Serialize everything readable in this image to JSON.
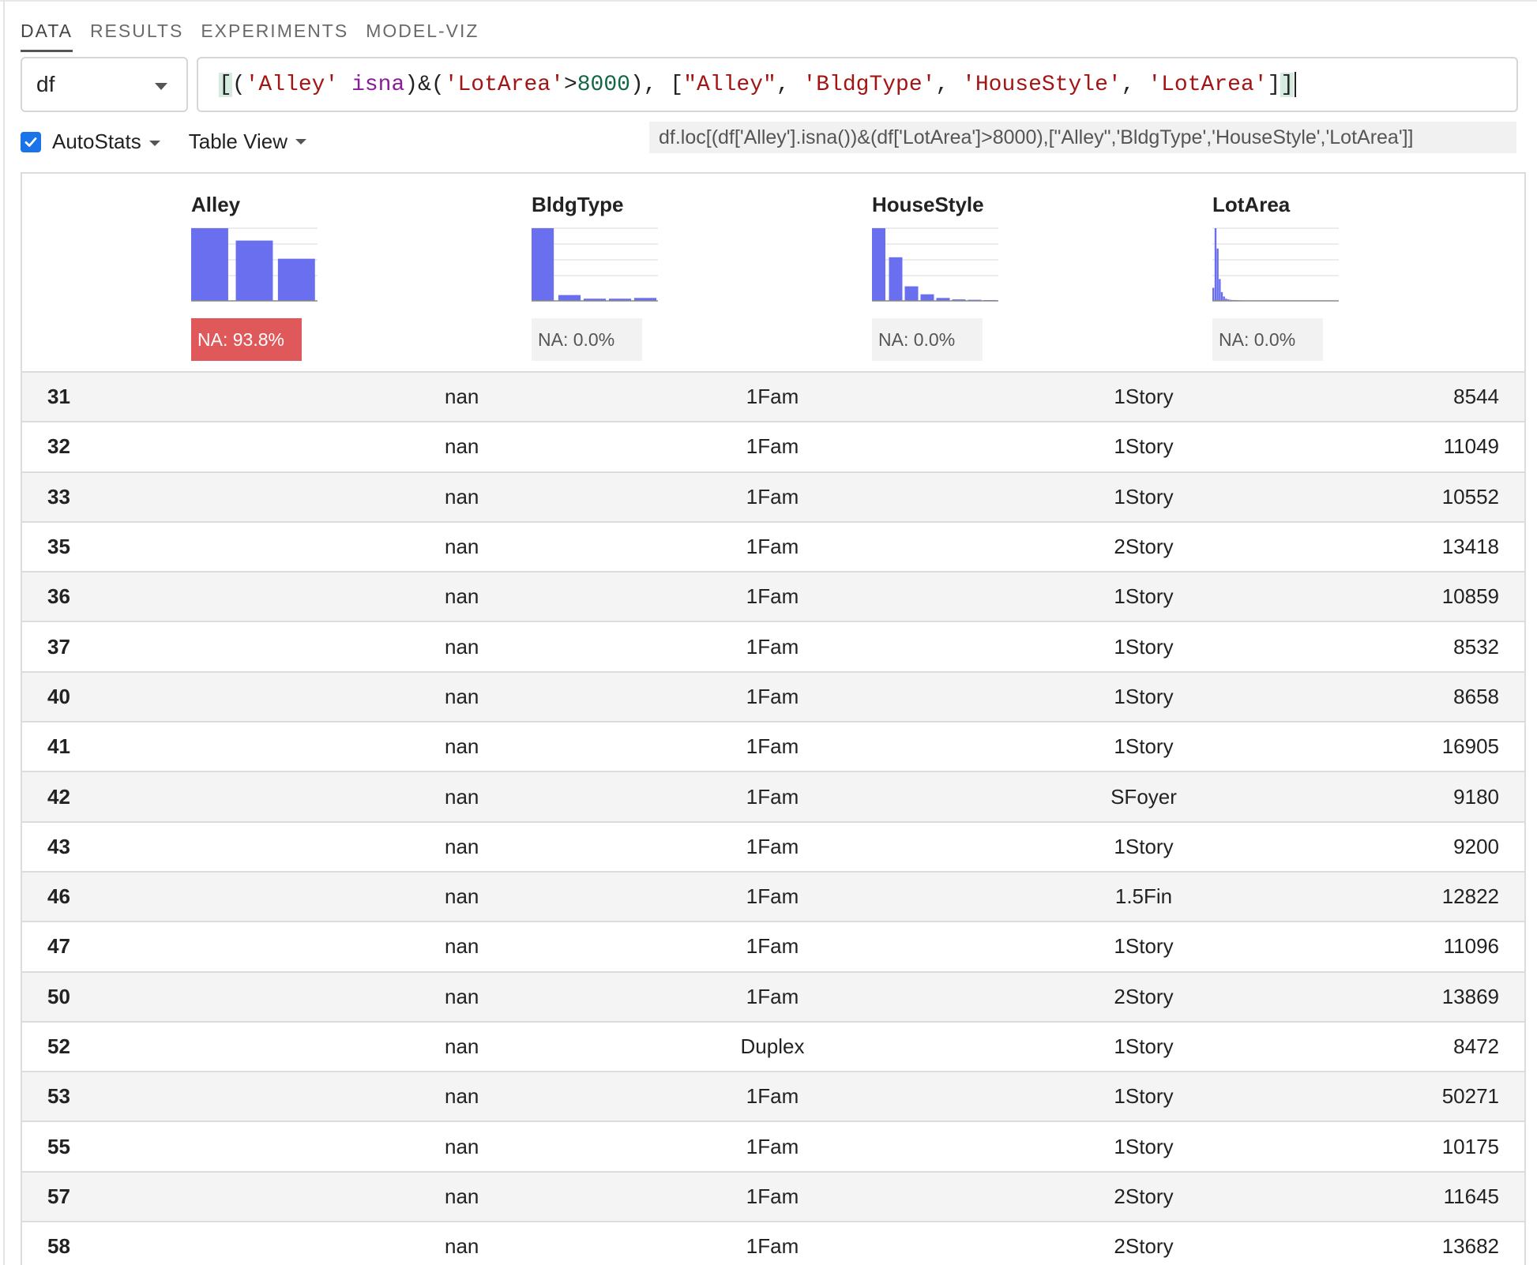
{
  "tabs": [
    {
      "label": "DATA",
      "active": true
    },
    {
      "label": "RESULTS",
      "active": false
    },
    {
      "label": "EXPERIMENTS",
      "active": false
    },
    {
      "label": "MODEL-VIZ",
      "active": false
    }
  ],
  "dataframe_select": {
    "value": "df"
  },
  "query": {
    "value": "[('Alley' isna)&('LotArea'>8000), [\"Alley\", 'BldgType', 'HouseStyle', 'LotArea']]"
  },
  "options": {
    "autostats_label": "AutoStats",
    "autostats_checked": true,
    "view_label": "Table View"
  },
  "code_preview": "df.loc[(df['Alley'].isna())&(df['LotArea']>8000),[\"Alley\",'BldgType','HouseStyle','LotArea']]",
  "columns": [
    {
      "name": "Alley",
      "na": "NA: 93.8%",
      "na_alert": true,
      "hist": [
        1.0,
        0.83,
        0.58
      ]
    },
    {
      "name": "BldgType",
      "na": "NA: 0.0%",
      "na_alert": false,
      "hist": [
        1.0,
        0.08,
        0.03,
        0.03,
        0.04
      ]
    },
    {
      "name": "HouseStyle",
      "na": "NA: 0.0%",
      "na_alert": false,
      "hist": [
        1.0,
        0.6,
        0.2,
        0.09,
        0.04,
        0.02,
        0.015,
        0.01
      ]
    },
    {
      "name": "LotArea",
      "na": "NA: 0.0%",
      "na_alert": false,
      "hist": [
        0.18,
        1.0,
        0.72,
        0.3,
        0.12,
        0.06,
        0.03,
        0.02,
        0.015,
        0.012,
        0.01,
        0.01,
        0.008,
        0.008,
        0.006,
        0.006,
        0.005,
        0.005,
        0.004,
        0.004,
        0.004,
        0.003,
        0.003,
        0.003,
        0.003,
        0.003,
        0.003,
        0.003,
        0.003,
        0.003,
        0.003,
        0.003,
        0.003,
        0.003,
        0.003,
        0.003,
        0.003,
        0.003,
        0.003,
        0.003,
        0.003,
        0.003,
        0.003,
        0.003,
        0.003,
        0.003,
        0.003,
        0.003,
        0.003,
        0.003,
        0.003,
        0.003,
        0.003,
        0.003,
        0.003,
        0.003,
        0.003,
        0.003,
        0.003,
        0.003
      ]
    }
  ],
  "rows": [
    {
      "idx": "31",
      "alley": "nan",
      "bldg": "1Fam",
      "style": "1Story",
      "lot": "8544"
    },
    {
      "idx": "32",
      "alley": "nan",
      "bldg": "1Fam",
      "style": "1Story",
      "lot": "11049"
    },
    {
      "idx": "33",
      "alley": "nan",
      "bldg": "1Fam",
      "style": "1Story",
      "lot": "10552"
    },
    {
      "idx": "35",
      "alley": "nan",
      "bldg": "1Fam",
      "style": "2Story",
      "lot": "13418"
    },
    {
      "idx": "36",
      "alley": "nan",
      "bldg": "1Fam",
      "style": "1Story",
      "lot": "10859"
    },
    {
      "idx": "37",
      "alley": "nan",
      "bldg": "1Fam",
      "style": "1Story",
      "lot": "8532"
    },
    {
      "idx": "40",
      "alley": "nan",
      "bldg": "1Fam",
      "style": "1Story",
      "lot": "8658"
    },
    {
      "idx": "41",
      "alley": "nan",
      "bldg": "1Fam",
      "style": "1Story",
      "lot": "16905"
    },
    {
      "idx": "42",
      "alley": "nan",
      "bldg": "1Fam",
      "style": "SFoyer",
      "lot": "9180"
    },
    {
      "idx": "43",
      "alley": "nan",
      "bldg": "1Fam",
      "style": "1Story",
      "lot": "9200"
    },
    {
      "idx": "46",
      "alley": "nan",
      "bldg": "1Fam",
      "style": "1.5Fin",
      "lot": "12822"
    },
    {
      "idx": "47",
      "alley": "nan",
      "bldg": "1Fam",
      "style": "1Story",
      "lot": "11096"
    },
    {
      "idx": "50",
      "alley": "nan",
      "bldg": "1Fam",
      "style": "2Story",
      "lot": "13869"
    },
    {
      "idx": "52",
      "alley": "nan",
      "bldg": "Duplex",
      "style": "1Story",
      "lot": "8472"
    },
    {
      "idx": "53",
      "alley": "nan",
      "bldg": "1Fam",
      "style": "1Story",
      "lot": "50271"
    },
    {
      "idx": "55",
      "alley": "nan",
      "bldg": "1Fam",
      "style": "1Story",
      "lot": "10175"
    },
    {
      "idx": "57",
      "alley": "nan",
      "bldg": "1Fam",
      "style": "2Story",
      "lot": "11645"
    },
    {
      "idx": "58",
      "alley": "nan",
      "bldg": "1Fam",
      "style": "2Story",
      "lot": "13682"
    }
  ],
  "colors": {
    "bar": "#6a6ff0",
    "na_alert": "#e0595a",
    "checkbox": "#1a73e8"
  }
}
